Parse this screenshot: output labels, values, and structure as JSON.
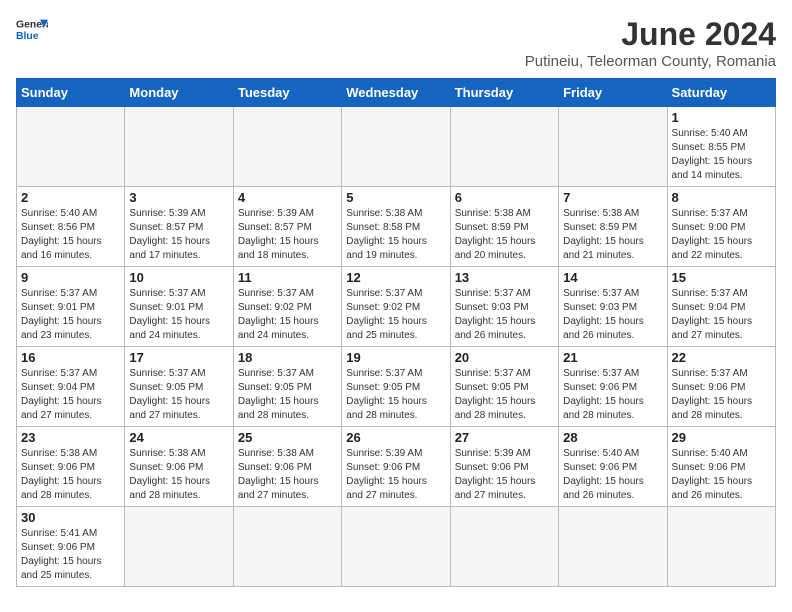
{
  "header": {
    "logo_general": "General",
    "logo_blue": "Blue",
    "month": "June 2024",
    "location": "Putineiu, Teleorman County, Romania"
  },
  "weekdays": [
    "Sunday",
    "Monday",
    "Tuesday",
    "Wednesday",
    "Thursday",
    "Friday",
    "Saturday"
  ],
  "days": [
    {
      "date": "",
      "info": ""
    },
    {
      "date": "",
      "info": ""
    },
    {
      "date": "",
      "info": ""
    },
    {
      "date": "",
      "info": ""
    },
    {
      "date": "",
      "info": ""
    },
    {
      "date": "",
      "info": ""
    },
    {
      "date": "1",
      "info": "Sunrise: 5:40 AM\nSunset: 8:55 PM\nDaylight: 15 hours and 14 minutes."
    },
    {
      "date": "2",
      "info": "Sunrise: 5:40 AM\nSunset: 8:56 PM\nDaylight: 15 hours and 16 minutes."
    },
    {
      "date": "3",
      "info": "Sunrise: 5:39 AM\nSunset: 8:57 PM\nDaylight: 15 hours and 17 minutes."
    },
    {
      "date": "4",
      "info": "Sunrise: 5:39 AM\nSunset: 8:57 PM\nDaylight: 15 hours and 18 minutes."
    },
    {
      "date": "5",
      "info": "Sunrise: 5:38 AM\nSunset: 8:58 PM\nDaylight: 15 hours and 19 minutes."
    },
    {
      "date": "6",
      "info": "Sunrise: 5:38 AM\nSunset: 8:59 PM\nDaylight: 15 hours and 20 minutes."
    },
    {
      "date": "7",
      "info": "Sunrise: 5:38 AM\nSunset: 8:59 PM\nDaylight: 15 hours and 21 minutes."
    },
    {
      "date": "8",
      "info": "Sunrise: 5:37 AM\nSunset: 9:00 PM\nDaylight: 15 hours and 22 minutes."
    },
    {
      "date": "9",
      "info": "Sunrise: 5:37 AM\nSunset: 9:01 PM\nDaylight: 15 hours and 23 minutes."
    },
    {
      "date": "10",
      "info": "Sunrise: 5:37 AM\nSunset: 9:01 PM\nDaylight: 15 hours and 24 minutes."
    },
    {
      "date": "11",
      "info": "Sunrise: 5:37 AM\nSunset: 9:02 PM\nDaylight: 15 hours and 24 minutes."
    },
    {
      "date": "12",
      "info": "Sunrise: 5:37 AM\nSunset: 9:02 PM\nDaylight: 15 hours and 25 minutes."
    },
    {
      "date": "13",
      "info": "Sunrise: 5:37 AM\nSunset: 9:03 PM\nDaylight: 15 hours and 26 minutes."
    },
    {
      "date": "14",
      "info": "Sunrise: 5:37 AM\nSunset: 9:03 PM\nDaylight: 15 hours and 26 minutes."
    },
    {
      "date": "15",
      "info": "Sunrise: 5:37 AM\nSunset: 9:04 PM\nDaylight: 15 hours and 27 minutes."
    },
    {
      "date": "16",
      "info": "Sunrise: 5:37 AM\nSunset: 9:04 PM\nDaylight: 15 hours and 27 minutes."
    },
    {
      "date": "17",
      "info": "Sunrise: 5:37 AM\nSunset: 9:05 PM\nDaylight: 15 hours and 27 minutes."
    },
    {
      "date": "18",
      "info": "Sunrise: 5:37 AM\nSunset: 9:05 PM\nDaylight: 15 hours and 28 minutes."
    },
    {
      "date": "19",
      "info": "Sunrise: 5:37 AM\nSunset: 9:05 PM\nDaylight: 15 hours and 28 minutes."
    },
    {
      "date": "20",
      "info": "Sunrise: 5:37 AM\nSunset: 9:05 PM\nDaylight: 15 hours and 28 minutes."
    },
    {
      "date": "21",
      "info": "Sunrise: 5:37 AM\nSunset: 9:06 PM\nDaylight: 15 hours and 28 minutes."
    },
    {
      "date": "22",
      "info": "Sunrise: 5:37 AM\nSunset: 9:06 PM\nDaylight: 15 hours and 28 minutes."
    },
    {
      "date": "23",
      "info": "Sunrise: 5:38 AM\nSunset: 9:06 PM\nDaylight: 15 hours and 28 minutes."
    },
    {
      "date": "24",
      "info": "Sunrise: 5:38 AM\nSunset: 9:06 PM\nDaylight: 15 hours and 28 minutes."
    },
    {
      "date": "25",
      "info": "Sunrise: 5:38 AM\nSunset: 9:06 PM\nDaylight: 15 hours and 27 minutes."
    },
    {
      "date": "26",
      "info": "Sunrise: 5:39 AM\nSunset: 9:06 PM\nDaylight: 15 hours and 27 minutes."
    },
    {
      "date": "27",
      "info": "Sunrise: 5:39 AM\nSunset: 9:06 PM\nDaylight: 15 hours and 27 minutes."
    },
    {
      "date": "28",
      "info": "Sunrise: 5:40 AM\nSunset: 9:06 PM\nDaylight: 15 hours and 26 minutes."
    },
    {
      "date": "29",
      "info": "Sunrise: 5:40 AM\nSunset: 9:06 PM\nDaylight: 15 hours and 26 minutes."
    },
    {
      "date": "30",
      "info": "Sunrise: 5:41 AM\nSunset: 9:06 PM\nDaylight: 15 hours and 25 minutes."
    },
    {
      "date": "",
      "info": ""
    },
    {
      "date": "",
      "info": ""
    },
    {
      "date": "",
      "info": ""
    },
    {
      "date": "",
      "info": ""
    },
    {
      "date": "",
      "info": ""
    },
    {
      "date": "",
      "info": ""
    }
  ]
}
